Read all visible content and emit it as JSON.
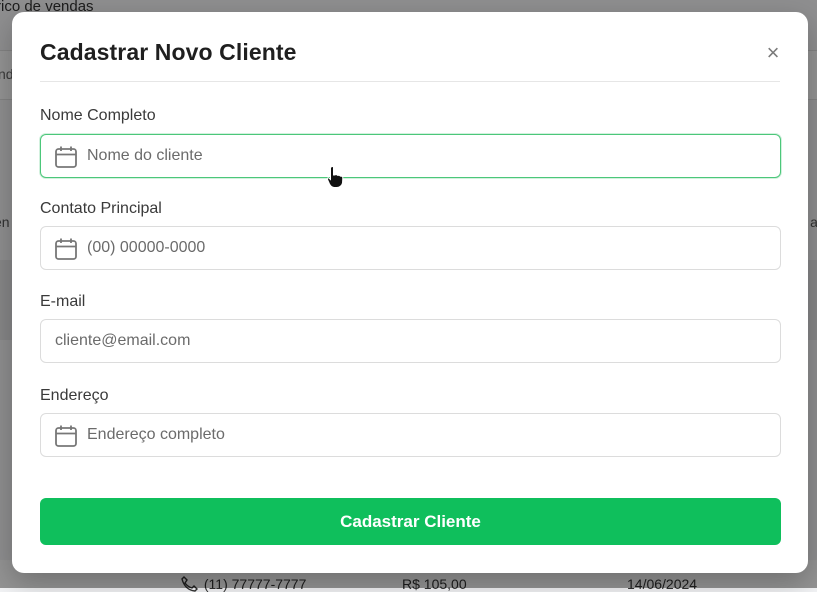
{
  "background": {
    "page_title": "rico de vendas",
    "row_text": "nd",
    "left_fragment": "en",
    "right_fragment": "al",
    "bottom_row": {
      "phone": "(11) 77777-7777",
      "value": "R$ 105,00",
      "date": "14/06/2024"
    }
  },
  "modal": {
    "title": "Cadastrar Novo Cliente",
    "close_label": "×",
    "fields": [
      {
        "label": "Nome Completo",
        "placeholder": "Nome do cliente",
        "icon": "calendar-icon"
      },
      {
        "label": "Contato Principal",
        "placeholder": "(00) 00000-0000",
        "icon": "calendar-icon"
      },
      {
        "label": "E-mail",
        "placeholder": "cliente@email.com",
        "icon": ""
      },
      {
        "label": "Endereço",
        "placeholder": "Endereço completo",
        "icon": "calendar-icon"
      }
    ],
    "submit_label": "Cadastrar Cliente"
  },
  "colors": {
    "accent": "#0fbf5c",
    "focus_border": "#4cc77a",
    "overlay": "rgba(0,0,0,0.42)"
  }
}
